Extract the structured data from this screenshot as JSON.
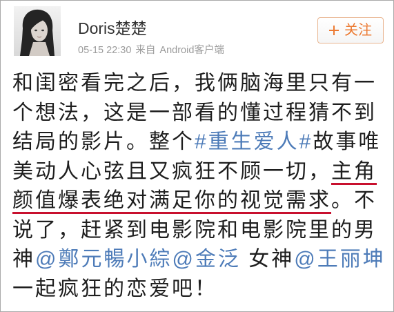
{
  "user": {
    "name": "Doris楚楚",
    "avatar_image": "woman-portrait-photo"
  },
  "meta": {
    "time": "05-15 22:30",
    "source_prefix": "来自",
    "source": "Android客户端"
  },
  "follow_button": {
    "icon": "plus-icon",
    "label": "关注"
  },
  "colors": {
    "link": "#4d7bb8",
    "underline_mark": "#c8102e",
    "follow_accent": "#ec7a32",
    "meta_text": "#9b9b9b"
  },
  "post": {
    "lines": [
      {
        "segments": [
          {
            "plain": "和闺密看完之后，我俩脑海里只有一"
          }
        ]
      },
      {
        "segments": [
          {
            "plain": "个想法，这是一部看的懂过程猜不到"
          }
        ]
      },
      {
        "segments": [
          {
            "plain": "结局的影片。整个"
          },
          {
            "topic": "#重生爱人#"
          },
          {
            "plain": "故事唯"
          }
        ]
      },
      {
        "segments": [
          {
            "plain": "美动人心弦且又疯狂不顾一切，"
          },
          {
            "underlined": "主角"
          }
        ]
      },
      {
        "segments": [
          {
            "underlined": "颜值爆表绝对满足你的视觉需求"
          },
          {
            "plain": "。不"
          }
        ]
      },
      {
        "segments": [
          {
            "plain": "说了，赶紧到电影院和电影院里的男"
          }
        ]
      },
      {
        "segments": [
          {
            "plain": "神"
          },
          {
            "mention": "@鄭元暢小綜"
          },
          {
            "mention": "@金泛"
          },
          {
            "plain": " 女神"
          },
          {
            "mention": "@王丽坤"
          }
        ]
      },
      {
        "segments": [
          {
            "plain": "一起疯狂的恋爱吧！"
          }
        ]
      }
    ]
  }
}
